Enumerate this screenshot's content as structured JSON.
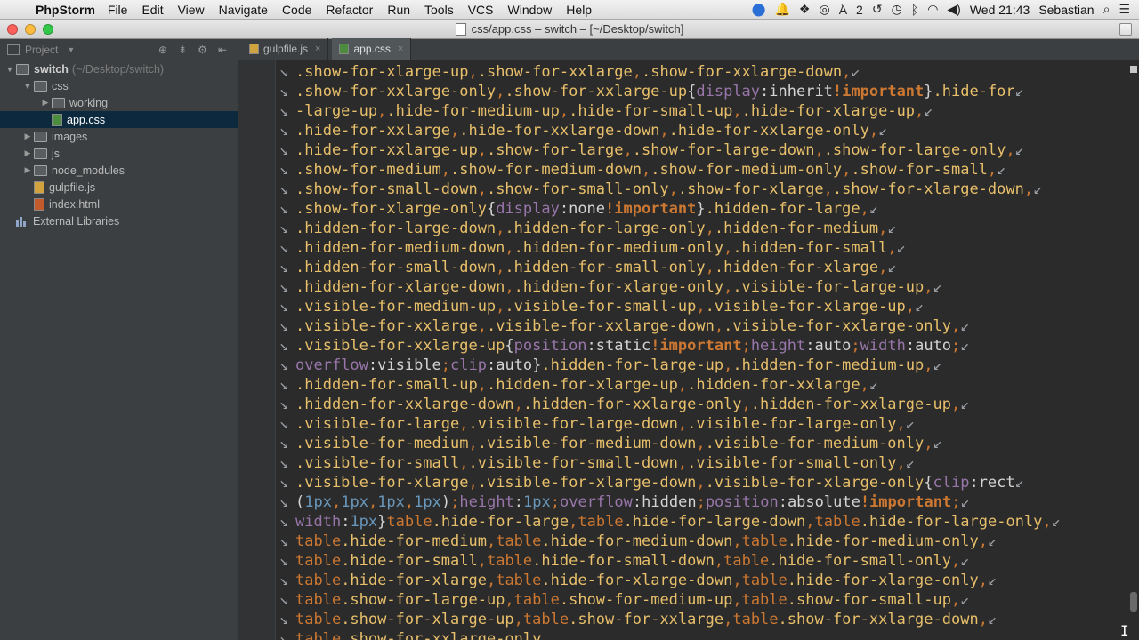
{
  "menubar": {
    "app": "PhpStorm",
    "items": [
      "File",
      "Edit",
      "View",
      "Navigate",
      "Code",
      "Refactor",
      "Run",
      "Tools",
      "VCS",
      "Window",
      "Help"
    ],
    "battery_label": "2",
    "clock": "Wed 21:43",
    "user": "Sebastian"
  },
  "window": {
    "title": "css/app.css – switch – [~/Desktop/switch]"
  },
  "project": {
    "header": "Project",
    "tree": [
      {
        "label": "switch",
        "sub": "(~/Desktop/switch)",
        "level": 0,
        "type": "folder",
        "expanded": true
      },
      {
        "label": "css",
        "level": 1,
        "type": "folder",
        "expanded": true
      },
      {
        "label": "working",
        "level": 2,
        "type": "folder",
        "expanded": false
      },
      {
        "label": "app.css",
        "level": 2,
        "type": "css",
        "selected": true
      },
      {
        "label": "images",
        "level": 1,
        "type": "folder",
        "expanded": false
      },
      {
        "label": "js",
        "level": 1,
        "type": "folder",
        "expanded": false
      },
      {
        "label": "node_modules",
        "level": 1,
        "type": "folder",
        "expanded": false
      },
      {
        "label": "gulpfile.js",
        "level": 1,
        "type": "js"
      },
      {
        "label": "index.html",
        "level": 1,
        "type": "html"
      },
      {
        "label": "External Libraries",
        "level": 0,
        "type": "lib"
      }
    ]
  },
  "tabs": [
    {
      "label": "gulpfile.js",
      "type": "js",
      "active": false
    },
    {
      "label": "app.css",
      "type": "css",
      "active": true
    }
  ],
  "colors": {
    "selector": "#e8bf6a",
    "keyword": "#cc7832",
    "property": "#9876aa",
    "number": "#6897bb",
    "text": "#d4d4d4",
    "background": "#2b2b2b",
    "panel": "#3c3f41",
    "selection": "#0d293e"
  },
  "code_lines": [
    [
      [
        "sel",
        ".show-for-xlarge-up"
      ],
      [
        "pun",
        ","
      ],
      [
        "sel",
        ".show-for-xxlarge"
      ],
      [
        "pun",
        ","
      ],
      [
        "sel",
        ".show-for-xxlarge-down"
      ],
      [
        "pun",
        ","
      ]
    ],
    [
      [
        "sel",
        ".show-for-xxlarge-only"
      ],
      [
        "pun",
        ","
      ],
      [
        "sel",
        ".show-for-xxlarge-up"
      ],
      [
        "plain",
        "{"
      ],
      [
        "prop",
        "display"
      ],
      [
        "plain",
        ":inherit"
      ],
      [
        "imp",
        "!important"
      ],
      [
        "plain",
        "}"
      ],
      [
        "sel",
        ".hide-for"
      ]
    ],
    [
      [
        "sel",
        "-large-up"
      ],
      [
        "pun",
        ","
      ],
      [
        "sel",
        ".hide-for-medium-up"
      ],
      [
        "pun",
        ","
      ],
      [
        "sel",
        ".hide-for-small-up"
      ],
      [
        "pun",
        ","
      ],
      [
        "sel",
        ".hide-for-xlarge-up"
      ],
      [
        "pun",
        ","
      ]
    ],
    [
      [
        "sel",
        ".hide-for-xxlarge"
      ],
      [
        "pun",
        ","
      ],
      [
        "sel",
        ".hide-for-xxlarge-down"
      ],
      [
        "pun",
        ","
      ],
      [
        "sel",
        ".hide-for-xxlarge-only"
      ],
      [
        "pun",
        ","
      ]
    ],
    [
      [
        "sel",
        ".hide-for-xxlarge-up"
      ],
      [
        "pun",
        ","
      ],
      [
        "sel",
        ".show-for-large"
      ],
      [
        "pun",
        ","
      ],
      [
        "sel",
        ".show-for-large-down"
      ],
      [
        "pun",
        ","
      ],
      [
        "sel",
        ".show-for-large-only"
      ],
      [
        "pun",
        ","
      ]
    ],
    [
      [
        "sel",
        ".show-for-medium"
      ],
      [
        "pun",
        ","
      ],
      [
        "sel",
        ".show-for-medium-down"
      ],
      [
        "pun",
        ","
      ],
      [
        "sel",
        ".show-for-medium-only"
      ],
      [
        "pun",
        ","
      ],
      [
        "sel",
        ".show-for-small"
      ],
      [
        "pun",
        ","
      ]
    ],
    [
      [
        "sel",
        ".show-for-small-down"
      ],
      [
        "pun",
        ","
      ],
      [
        "sel",
        ".show-for-small-only"
      ],
      [
        "pun",
        ","
      ],
      [
        "sel",
        ".show-for-xlarge"
      ],
      [
        "pun",
        ","
      ],
      [
        "sel",
        ".show-for-xlarge-down"
      ],
      [
        "pun",
        ","
      ]
    ],
    [
      [
        "sel",
        ".show-for-xlarge-only"
      ],
      [
        "plain",
        "{"
      ],
      [
        "prop",
        "display"
      ],
      [
        "plain",
        ":none"
      ],
      [
        "imp",
        "!important"
      ],
      [
        "plain",
        "}"
      ],
      [
        "sel",
        ".hidden-for-large"
      ],
      [
        "pun",
        ","
      ]
    ],
    [
      [
        "sel",
        ".hidden-for-large-down"
      ],
      [
        "pun",
        ","
      ],
      [
        "sel",
        ".hidden-for-large-only"
      ],
      [
        "pun",
        ","
      ],
      [
        "sel",
        ".hidden-for-medium"
      ],
      [
        "pun",
        ","
      ]
    ],
    [
      [
        "sel",
        ".hidden-for-medium-down"
      ],
      [
        "pun",
        ","
      ],
      [
        "sel",
        ".hidden-for-medium-only"
      ],
      [
        "pun",
        ","
      ],
      [
        "sel",
        ".hidden-for-small"
      ],
      [
        "pun",
        ","
      ]
    ],
    [
      [
        "sel",
        ".hidden-for-small-down"
      ],
      [
        "pun",
        ","
      ],
      [
        "sel",
        ".hidden-for-small-only"
      ],
      [
        "pun",
        ","
      ],
      [
        "sel",
        ".hidden-for-xlarge"
      ],
      [
        "pun",
        ","
      ]
    ],
    [
      [
        "sel",
        ".hidden-for-xlarge-down"
      ],
      [
        "pun",
        ","
      ],
      [
        "sel",
        ".hidden-for-xlarge-only"
      ],
      [
        "pun",
        ","
      ],
      [
        "sel",
        ".visible-for-large-up"
      ],
      [
        "pun",
        ","
      ]
    ],
    [
      [
        "sel",
        ".visible-for-medium-up"
      ],
      [
        "pun",
        ","
      ],
      [
        "sel",
        ".visible-for-small-up"
      ],
      [
        "pun",
        ","
      ],
      [
        "sel",
        ".visible-for-xlarge-up"
      ],
      [
        "pun",
        ","
      ]
    ],
    [
      [
        "sel",
        ".visible-for-xxlarge"
      ],
      [
        "pun",
        ","
      ],
      [
        "sel",
        ".visible-for-xxlarge-down"
      ],
      [
        "pun",
        ","
      ],
      [
        "sel",
        ".visible-for-xxlarge-only"
      ],
      [
        "pun",
        ","
      ]
    ],
    [
      [
        "sel",
        ".visible-for-xxlarge-up"
      ],
      [
        "plain",
        "{"
      ],
      [
        "prop",
        "position"
      ],
      [
        "plain",
        ":static"
      ],
      [
        "imp",
        "!important"
      ],
      [
        "pun",
        ";"
      ],
      [
        "prop",
        "height"
      ],
      [
        "plain",
        ":auto"
      ],
      [
        "pun",
        ";"
      ],
      [
        "prop",
        "width"
      ],
      [
        "plain",
        ":auto"
      ],
      [
        "pun",
        ";"
      ]
    ],
    [
      [
        "prop",
        "overflow"
      ],
      [
        "plain",
        ":visible"
      ],
      [
        "pun",
        ";"
      ],
      [
        "prop",
        "clip"
      ],
      [
        "plain",
        ":auto}"
      ],
      [
        "sel",
        ".hidden-for-large-up"
      ],
      [
        "pun",
        ","
      ],
      [
        "sel",
        ".hidden-for-medium-up"
      ],
      [
        "pun",
        ","
      ]
    ],
    [
      [
        "sel",
        ".hidden-for-small-up"
      ],
      [
        "pun",
        ","
      ],
      [
        "sel",
        ".hidden-for-xlarge-up"
      ],
      [
        "pun",
        ","
      ],
      [
        "sel",
        ".hidden-for-xxlarge"
      ],
      [
        "pun",
        ","
      ]
    ],
    [
      [
        "sel",
        ".hidden-for-xxlarge-down"
      ],
      [
        "pun",
        ","
      ],
      [
        "sel",
        ".hidden-for-xxlarge-only"
      ],
      [
        "pun",
        ","
      ],
      [
        "sel",
        ".hidden-for-xxlarge-up"
      ],
      [
        "pun",
        ","
      ]
    ],
    [
      [
        "sel",
        ".visible-for-large"
      ],
      [
        "pun",
        ","
      ],
      [
        "sel",
        ".visible-for-large-down"
      ],
      [
        "pun",
        ","
      ],
      [
        "sel",
        ".visible-for-large-only"
      ],
      [
        "pun",
        ","
      ]
    ],
    [
      [
        "sel",
        ".visible-for-medium"
      ],
      [
        "pun",
        ","
      ],
      [
        "sel",
        ".visible-for-medium-down"
      ],
      [
        "pun",
        ","
      ],
      [
        "sel",
        ".visible-for-medium-only"
      ],
      [
        "pun",
        ","
      ]
    ],
    [
      [
        "sel",
        ".visible-for-small"
      ],
      [
        "pun",
        ","
      ],
      [
        "sel",
        ".visible-for-small-down"
      ],
      [
        "pun",
        ","
      ],
      [
        "sel",
        ".visible-for-small-only"
      ],
      [
        "pun",
        ","
      ]
    ],
    [
      [
        "sel",
        ".visible-for-xlarge"
      ],
      [
        "pun",
        ","
      ],
      [
        "sel",
        ".visible-for-xlarge-down"
      ],
      [
        "pun",
        ","
      ],
      [
        "sel",
        ".visible-for-xlarge-only"
      ],
      [
        "plain",
        "{"
      ],
      [
        "prop",
        "clip"
      ],
      [
        "plain",
        ":rect"
      ]
    ],
    [
      [
        "plain",
        "("
      ],
      [
        "num",
        "1px"
      ],
      [
        "pun",
        ","
      ],
      [
        "num",
        "1px"
      ],
      [
        "pun",
        ","
      ],
      [
        "num",
        "1px"
      ],
      [
        "pun",
        ","
      ],
      [
        "num",
        "1px"
      ],
      [
        "plain",
        ")"
      ],
      [
        "pun",
        ";"
      ],
      [
        "prop",
        "height"
      ],
      [
        "plain",
        ":"
      ],
      [
        "num",
        "1px"
      ],
      [
        "pun",
        ";"
      ],
      [
        "prop",
        "overflow"
      ],
      [
        "plain",
        ":hidden"
      ],
      [
        "pun",
        ";"
      ],
      [
        "prop",
        "position"
      ],
      [
        "plain",
        ":absolute"
      ],
      [
        "imp",
        "!important"
      ],
      [
        "pun",
        ";"
      ]
    ],
    [
      [
        "prop",
        "width"
      ],
      [
        "plain",
        ":"
      ],
      [
        "num",
        "1px"
      ],
      [
        "plain",
        "}"
      ],
      [
        "kw",
        "table"
      ],
      [
        "sel",
        ".hide-for-large"
      ],
      [
        "pun",
        ","
      ],
      [
        "kw",
        "table"
      ],
      [
        "sel",
        ".hide-for-large-down"
      ],
      [
        "pun",
        ","
      ],
      [
        "kw",
        "table"
      ],
      [
        "sel",
        ".hide-for-large-only"
      ],
      [
        "pun",
        ","
      ]
    ],
    [
      [
        "kw",
        "table"
      ],
      [
        "sel",
        ".hide-for-medium"
      ],
      [
        "pun",
        ","
      ],
      [
        "kw",
        "table"
      ],
      [
        "sel",
        ".hide-for-medium-down"
      ],
      [
        "pun",
        ","
      ],
      [
        "kw",
        "table"
      ],
      [
        "sel",
        ".hide-for-medium-only"
      ],
      [
        "pun",
        ","
      ]
    ],
    [
      [
        "kw",
        "table"
      ],
      [
        "sel",
        ".hide-for-small"
      ],
      [
        "pun",
        ","
      ],
      [
        "kw",
        "table"
      ],
      [
        "sel",
        ".hide-for-small-down"
      ],
      [
        "pun",
        ","
      ],
      [
        "kw",
        "table"
      ],
      [
        "sel",
        ".hide-for-small-only"
      ],
      [
        "pun",
        ","
      ]
    ],
    [
      [
        "kw",
        "table"
      ],
      [
        "sel",
        ".hide-for-xlarge"
      ],
      [
        "pun",
        ","
      ],
      [
        "kw",
        "table"
      ],
      [
        "sel",
        ".hide-for-xlarge-down"
      ],
      [
        "pun",
        ","
      ],
      [
        "kw",
        "table"
      ],
      [
        "sel",
        ".hide-for-xlarge-only"
      ],
      [
        "pun",
        ","
      ]
    ],
    [
      [
        "kw",
        "table"
      ],
      [
        "sel",
        ".show-for-large-up"
      ],
      [
        "pun",
        ","
      ],
      [
        "kw",
        "table"
      ],
      [
        "sel",
        ".show-for-medium-up"
      ],
      [
        "pun",
        ","
      ],
      [
        "kw",
        "table"
      ],
      [
        "sel",
        ".show-for-small-up"
      ],
      [
        "pun",
        ","
      ]
    ],
    [
      [
        "kw",
        "table"
      ],
      [
        "sel",
        ".show-for-xlarge-up"
      ],
      [
        "pun",
        ","
      ],
      [
        "kw",
        "table"
      ],
      [
        "sel",
        ".show-for-xxlarge"
      ],
      [
        "pun",
        ","
      ],
      [
        "kw",
        "table"
      ],
      [
        "sel",
        ".show-for-xxlarge-down"
      ],
      [
        "pun",
        ","
      ]
    ],
    [
      [
        "kw",
        "table"
      ],
      [
        "sel",
        ".show-for-xxlarge-only"
      ],
      [
        "pun",
        ","
      ]
    ]
  ],
  "code_line_prefix": [
    true,
    true,
    false,
    true,
    true,
    true,
    true,
    true,
    true,
    true,
    true,
    true,
    true,
    true,
    true,
    false,
    true,
    true,
    true,
    true,
    true,
    true,
    false,
    false,
    false,
    false,
    false,
    false,
    false,
    false
  ],
  "code_line_wrap": [
    true,
    true,
    true,
    true,
    true,
    true,
    true,
    true,
    true,
    true,
    true,
    true,
    true,
    true,
    true,
    true,
    true,
    true,
    true,
    true,
    true,
    true,
    true,
    true,
    true,
    true,
    true,
    true,
    true,
    true
  ]
}
